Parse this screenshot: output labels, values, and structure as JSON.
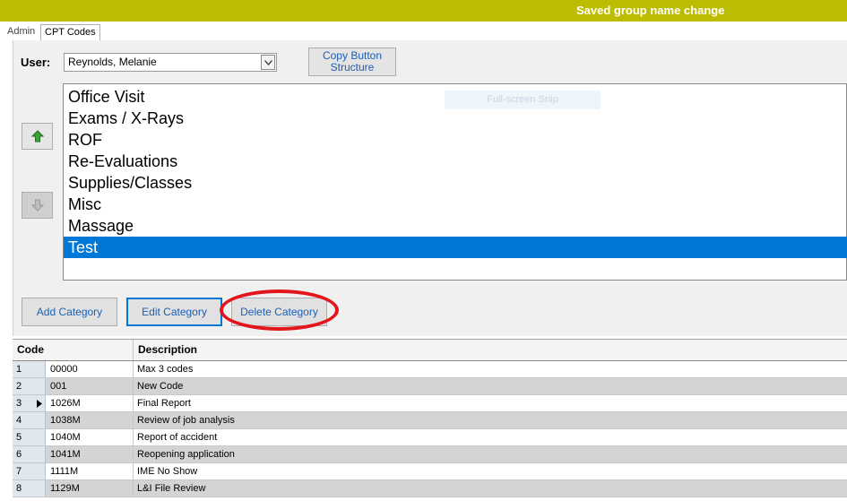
{
  "status_bar": {
    "message": "Saved group name change",
    "background": "#bcbc00"
  },
  "tabs": [
    {
      "label": "Admin"
    },
    {
      "label": "CPT Codes",
      "active": true
    }
  ],
  "user": {
    "label": "User:",
    "value": "Reynolds, Melanie"
  },
  "copy_button": {
    "line1": "Copy Button",
    "line2": "Structure"
  },
  "arrow_buttons": {
    "up_icon": "arrow-up-icon",
    "down_icon": "arrow-down-icon"
  },
  "categories": [
    {
      "label": "Office Visit"
    },
    {
      "label": "Exams / X-Rays"
    },
    {
      "label": "ROF"
    },
    {
      "label": "Re-Evaluations"
    },
    {
      "label": "Supplies/Classes"
    },
    {
      "label": "Misc"
    },
    {
      "label": "Massage"
    },
    {
      "label": "Test",
      "selected": true
    }
  ],
  "overlay": {
    "snip_label": "Full-screen Snip"
  },
  "category_buttons": {
    "add": "Add Category",
    "edit": "Edit Category",
    "delete": "Delete Category"
  },
  "highlight_color": "#e3161c",
  "selection_color": "#0078d7",
  "grid": {
    "columns": {
      "code": "Code",
      "description": "Description"
    },
    "rows": [
      {
        "num": "1",
        "code": "00000",
        "description": "Max 3 codes"
      },
      {
        "num": "2",
        "code": "001",
        "description": "New Code"
      },
      {
        "num": "3",
        "code": "1026M",
        "description": "Final Report",
        "current": true
      },
      {
        "num": "4",
        "code": "1038M",
        "description": "Review of job analysis"
      },
      {
        "num": "5",
        "code": "1040M",
        "description": "Report of accident"
      },
      {
        "num": "6",
        "code": "1041M",
        "description": "Reopening application"
      },
      {
        "num": "7",
        "code": "1111M",
        "description": "IME No Show"
      },
      {
        "num": "8",
        "code": "1129M",
        "description": "L&I File Review"
      }
    ]
  }
}
